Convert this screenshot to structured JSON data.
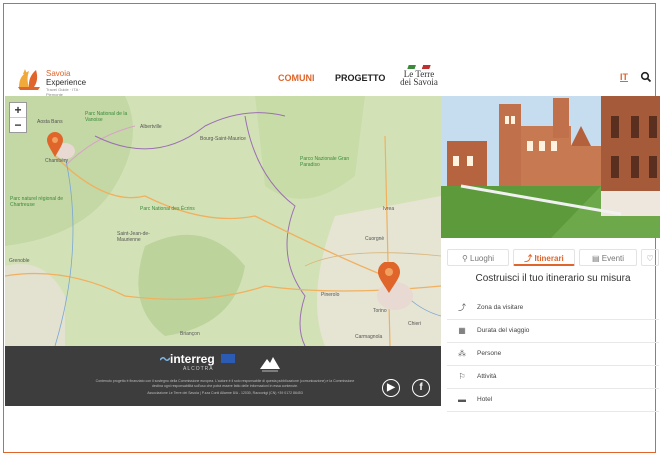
{
  "brand": {
    "name_line1": "Savoia",
    "name_line2": "Experience",
    "tagline": "Travel Guide · ITA · Piemonte",
    "accent": "#e0652a"
  },
  "nav": {
    "items": [
      {
        "label": "COMUNI",
        "active": true
      },
      {
        "label": "PROGETTO",
        "active": false
      }
    ],
    "partner_logo": {
      "line1": "Le Terre",
      "line2": "dei Savoia"
    },
    "language": "IT",
    "search_icon": "search-icon"
  },
  "map": {
    "zoom_in": "+",
    "zoom_out": "−",
    "labels": [
      {
        "text": "Aosta Bans"
      },
      {
        "text": "Parc National de la Vanoise"
      },
      {
        "text": "Albertville"
      },
      {
        "text": "Bourg-Saint-Maurice"
      },
      {
        "text": "Parco Nazionale Gran Paradiso"
      },
      {
        "text": "Parc naturel régional de Chartreuse"
      },
      {
        "text": "Saint-Jean-de-Maurienne"
      },
      {
        "text": "Parc National des Écrins"
      },
      {
        "text": "Grenoble"
      },
      {
        "text": "Torino"
      },
      {
        "text": "Pinerolo"
      },
      {
        "text": "Briançon"
      },
      {
        "text": "Chambéry"
      },
      {
        "text": "Ivrea"
      },
      {
        "text": "Cuorgnè"
      },
      {
        "text": "Chieri"
      },
      {
        "text": "Carmagnola"
      }
    ],
    "marker_icon": "map-pin-icon"
  },
  "footer": {
    "interreg": "interreg",
    "alcotra": "ALCOTRA",
    "fine_print": "Contenuto progetto è finanziato con il sostegno della Commissione europea. L'autore è il solo responsabile di questa pubblicazione (comunicazione) e la Commissione declina ogni responsabilità sull'uso che potrà essere fatto delle informazioni in essa contenute.",
    "address": "Associazione Le Terre dei Savoia | P.zza Conti Allarme 8/A - 12030, Racconigi (CN) +39 0172 86453",
    "social": [
      {
        "name": "youtube",
        "glyph": "▶"
      },
      {
        "name": "facebook",
        "glyph": "f"
      }
    ]
  },
  "panel": {
    "tabs": [
      {
        "label": "Luoghi",
        "icon": "person-pin-icon",
        "glyph": "⚲",
        "active": false
      },
      {
        "label": "Itinerari",
        "icon": "route-icon",
        "glyph": "⤴",
        "active": true
      },
      {
        "label": "Eventi",
        "icon": "calendar-icon",
        "glyph": "▤",
        "active": false
      }
    ],
    "favorite_glyph": "♡",
    "title": "Costruisci il tuo itinerario su misura",
    "options": [
      {
        "label": "Zona da visitare",
        "icon": "route-icon",
        "glyph": "⤴"
      },
      {
        "label": "Durata del viaggio",
        "icon": "calendar-icon",
        "glyph": "▦"
      },
      {
        "label": "Persone",
        "icon": "people-icon",
        "glyph": "⁂"
      },
      {
        "label": "Attività",
        "icon": "activity-icon",
        "glyph": "⚐"
      },
      {
        "label": "Hotel",
        "icon": "hotel-icon",
        "glyph": "▬"
      }
    ]
  }
}
